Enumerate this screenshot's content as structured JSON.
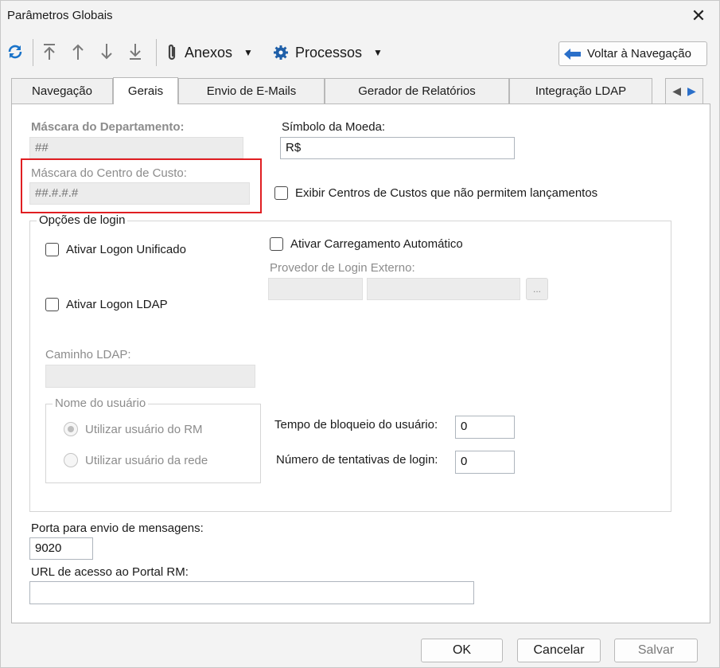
{
  "window": {
    "title": "Parâmetros Globais"
  },
  "toolbar": {
    "anexos_label": "Anexos",
    "processos_label": "Processos",
    "voltar_label": "Voltar à Navegação",
    "icons": [
      "refresh-icon",
      "move-first-icon",
      "move-up-icon",
      "move-down-icon",
      "move-last-icon",
      "paperclip-icon",
      "gear-icon",
      "back-arrow-icon"
    ]
  },
  "tabs": [
    {
      "label": "Navegação",
      "active": false
    },
    {
      "label": "Gerais",
      "active": true
    },
    {
      "label": "Envio de E-Mails",
      "active": false
    },
    {
      "label": "Gerador de Relatórios",
      "active": false
    },
    {
      "label": "Integração LDAP",
      "active": false
    }
  ],
  "general": {
    "mascara_departamento": {
      "label": "Máscara do Departamento:",
      "value": "##"
    },
    "simbolo_moeda": {
      "label": "Símbolo da Moeda:",
      "value": "R$"
    },
    "mascara_centro_custo": {
      "label": "Máscara do Centro de Custo:",
      "value": "##.#.#.#"
    },
    "exibir_centros_label": "Exibir Centros de Custos que não permitem lançamentos"
  },
  "login": {
    "group_label": "Opções de login",
    "logon_unificado_label": "Ativar Logon Unificado",
    "carregamento_automatico_label": "Ativar Carregamento Automático",
    "provedor_label": "Provedor de Login Externo:",
    "ellipsis_label": "...",
    "logon_ldap_label": "Ativar Logon LDAP",
    "caminho_ldap_label": "Caminho LDAP:",
    "nome_usuario": {
      "group_label": "Nome do usuário",
      "option_rm": "Utilizar usuário do RM",
      "option_rede": "Utilizar usuário da rede"
    },
    "tempo_bloqueio": {
      "label": "Tempo de bloqueio do usuário:",
      "value": "0"
    },
    "tentativas": {
      "label": "Número de tentativas de login:",
      "value": "0"
    }
  },
  "mensagens": {
    "label": "Porta para envio de mensagens:",
    "value": "9020"
  },
  "portal": {
    "label": "URL de acesso ao Portal RM:",
    "value": ""
  },
  "buttons": {
    "ok": "OK",
    "cancelar": "Cancelar",
    "salvar": "Salvar"
  },
  "colors": {
    "highlight": "#e01e22",
    "accent_blue": "#1a73c9"
  }
}
